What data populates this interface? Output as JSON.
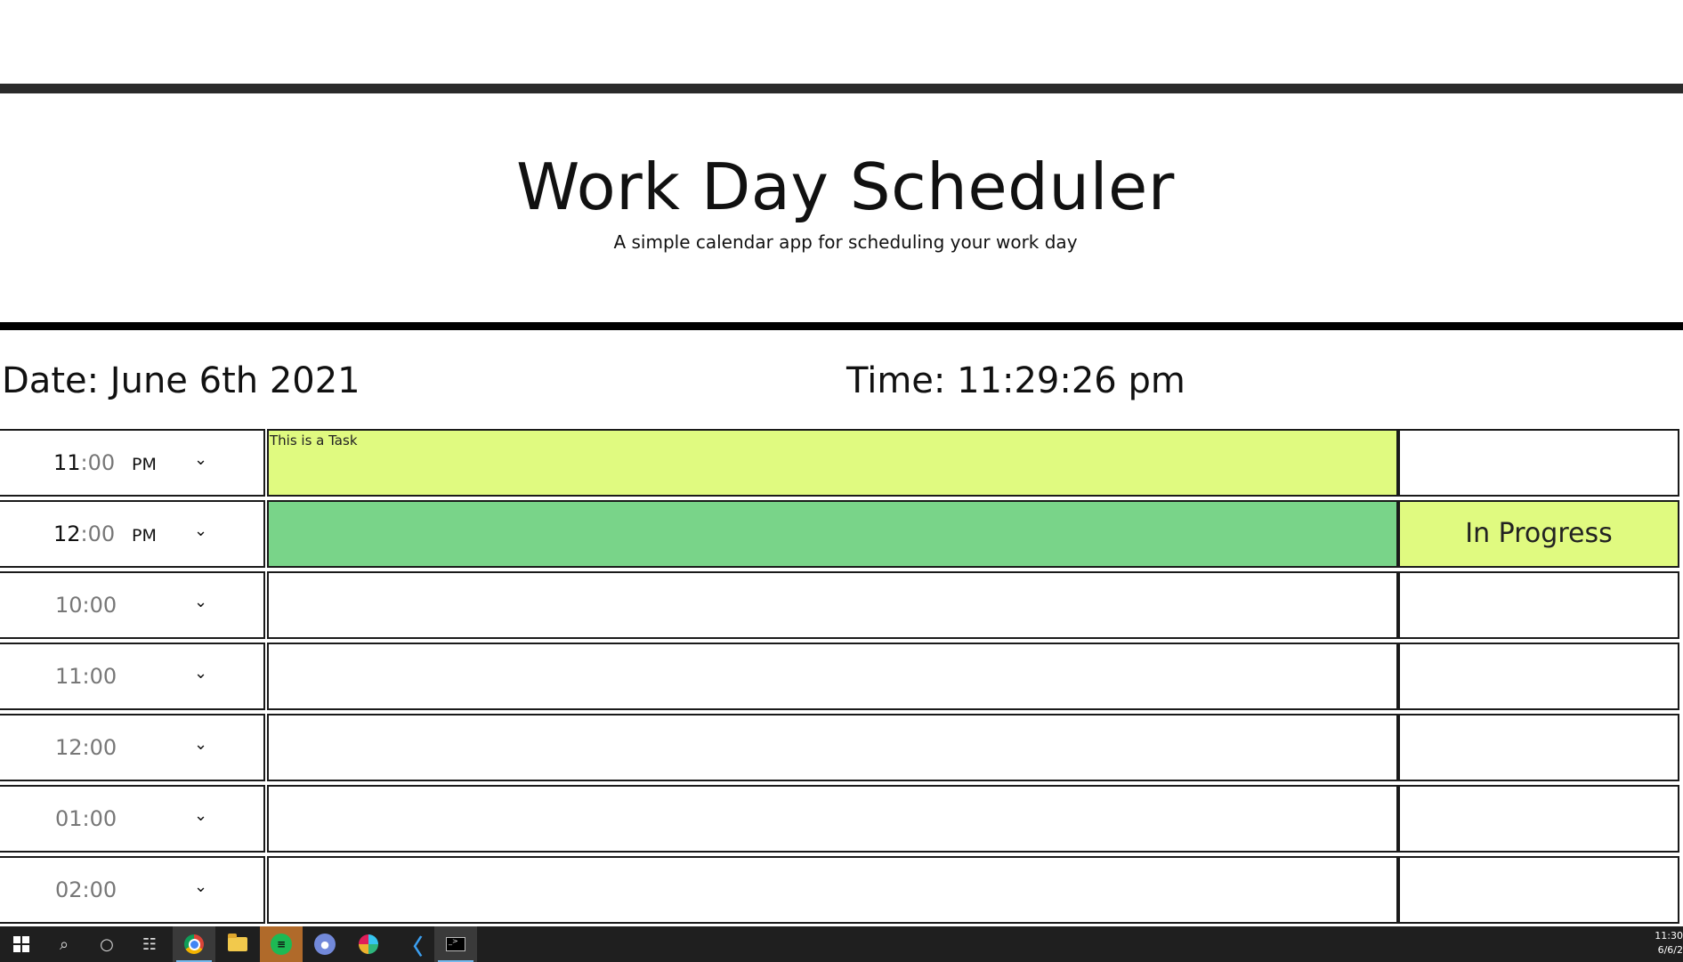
{
  "header": {
    "title": "Work Day Scheduler",
    "subtitle": "A simple calendar app for scheduling your work day"
  },
  "info": {
    "date": "Date: June 6th 2021",
    "time": "Time: 11:29:26 pm"
  },
  "rows": [
    {
      "hour": "11",
      "minutes": ":00",
      "ampm": "PM",
      "task": "This is a Task",
      "status": "",
      "task_color": "#e0fa80"
    },
    {
      "hour": "12",
      "minutes": ":00",
      "ampm": "PM",
      "task": "",
      "status": "In Progress",
      "task_color": "#79d489",
      "status_color": "#e0fa80"
    },
    {
      "hour": "10:00",
      "ampm": "",
      "task": "",
      "status": ""
    },
    {
      "hour": "11:00",
      "ampm": "",
      "task": "",
      "status": ""
    },
    {
      "hour": "12:00",
      "ampm": "",
      "task": "",
      "status": ""
    },
    {
      "hour": "01:00",
      "ampm": "",
      "task": "",
      "status": ""
    },
    {
      "hour": "02:00",
      "ampm": "",
      "task": "",
      "status": ""
    }
  ],
  "taskbar": {
    "icons": [
      "windows-start-icon",
      "search-icon",
      "cortana-icon",
      "task-view-icon",
      "chrome-icon",
      "file-explorer-icon",
      "spotify-icon",
      "discord-icon",
      "slack-icon",
      "vscode-icon",
      "terminal-icon"
    ],
    "clock_time": "11:30",
    "clock_date": "6/6/2"
  }
}
